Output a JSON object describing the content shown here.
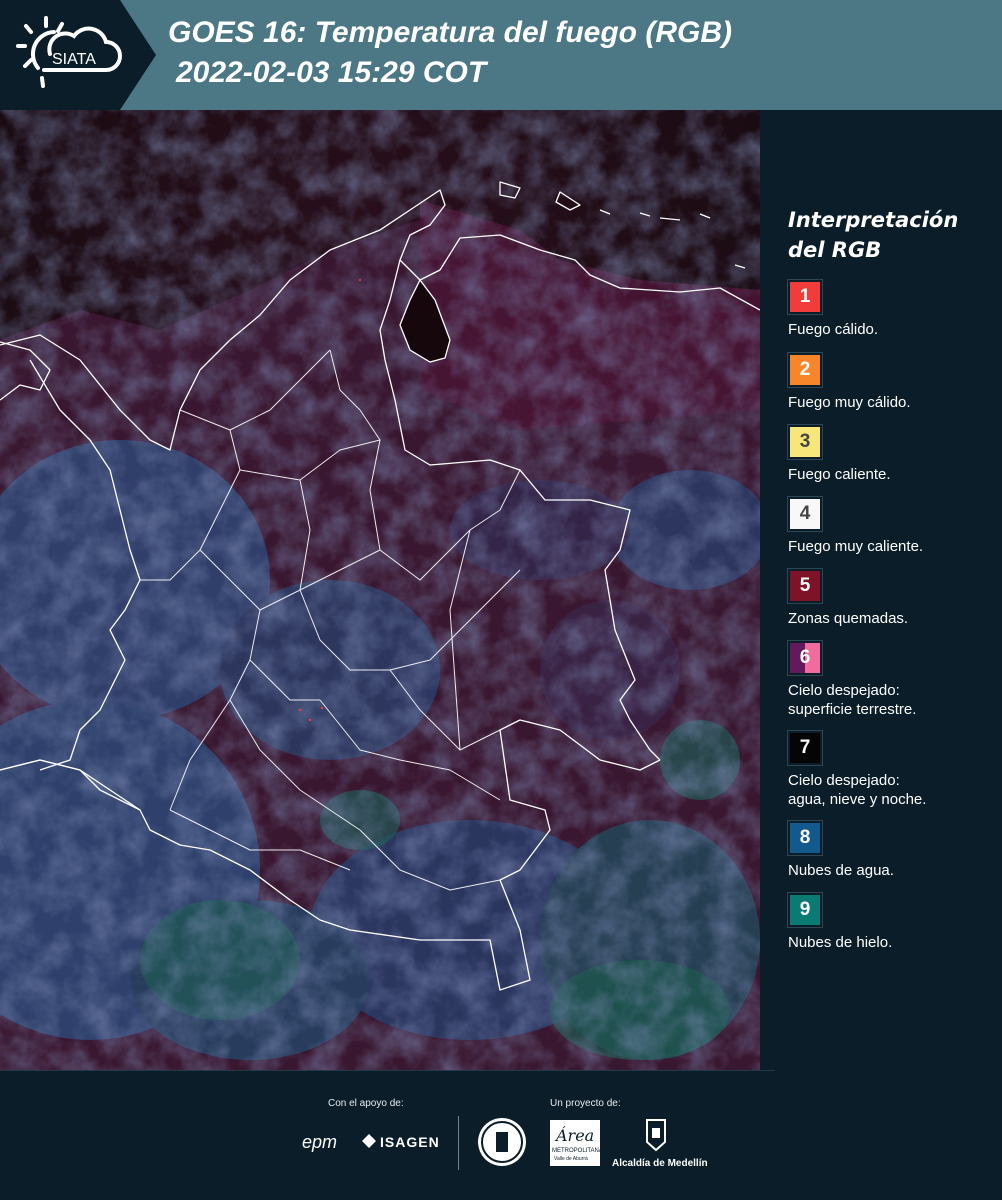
{
  "header": {
    "logo_text": "SIATA",
    "title_line1": "GOES 16: Temperatura del fuego (RGB)",
    "title_line2": "2022-02-03 15:29 COT"
  },
  "legend": {
    "title_line1": "Interpretación",
    "title_line2": "del RGB",
    "items": [
      {
        "number": "1",
        "color": "#f23b3b",
        "color2": "",
        "label_line1": "Fuego cálido.",
        "label_line2": ""
      },
      {
        "number": "2",
        "color": "#f7862a",
        "color2": "",
        "label_line1": "Fuego muy cálido.",
        "label_line2": ""
      },
      {
        "number": "3",
        "color": "#f7e67a",
        "color2": "",
        "label_line1": "Fuego caliente.",
        "label_line2": ""
      },
      {
        "number": "4",
        "color": "#f8f8f8",
        "color2": "",
        "label_line1": "Fuego muy caliente.",
        "label_line2": ""
      },
      {
        "number": "5",
        "color": "#7e1328",
        "color2": "",
        "label_line1": "Zonas quemadas.",
        "label_line2": ""
      },
      {
        "number": "6",
        "color": "#611a5c",
        "color2": "#f26b9d",
        "label_line1": "Cielo despejado:",
        "label_line2": "superficie terrestre."
      },
      {
        "number": "7",
        "color": "#050505",
        "color2": "",
        "label_line1": "Cielo despejado:",
        "label_line2": "agua, nieve y noche."
      },
      {
        "number": "8",
        "color": "#125a8c",
        "color2": "",
        "label_line1": "Nubes de agua.",
        "label_line2": ""
      },
      {
        "number": "9",
        "color": "#0a7a73",
        "color2": "",
        "label_line1": "Nubes de hielo.",
        "label_line2": ""
      }
    ]
  },
  "footer": {
    "support_label": "Con el apoyo de:",
    "project_label": "Un proyecto de:",
    "sponsors": [
      "epm",
      "ISAGEN",
      "METROPOLITANA",
      "Alcaldía de Medellín"
    ],
    "area_logo_text": "Área",
    "area_sub_text": "Valle de Aburrá"
  },
  "colors": {
    "background": "#0b1d28",
    "header_band": "#4c7785",
    "border_lines": "#ffffff"
  }
}
